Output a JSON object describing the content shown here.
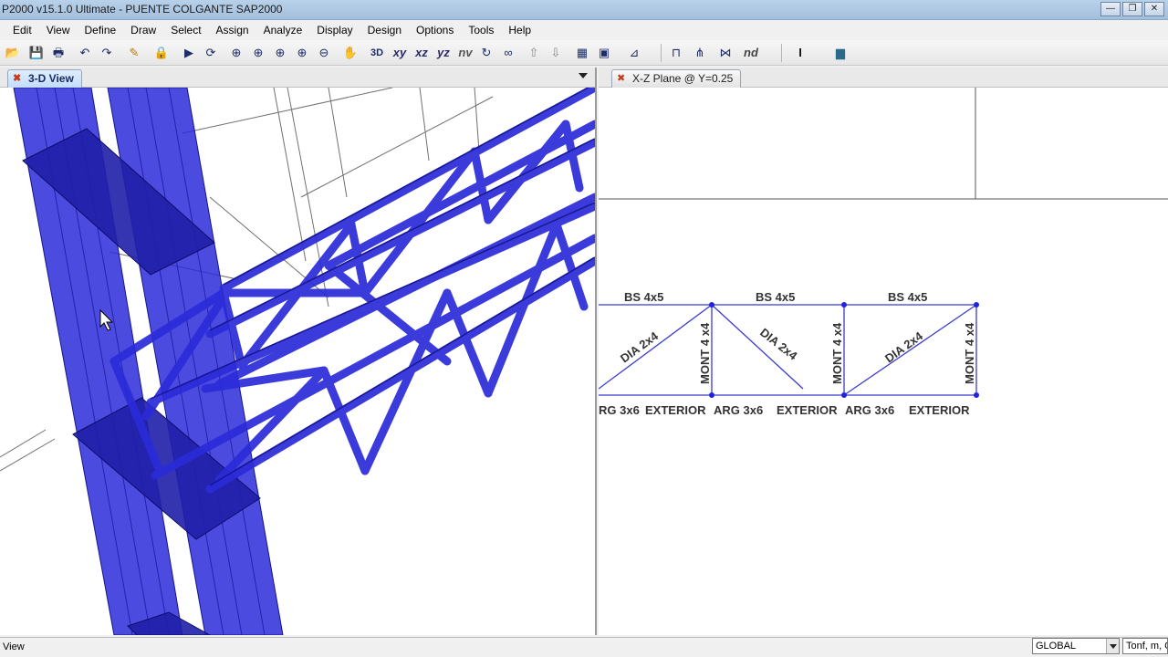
{
  "window": {
    "title": "P2000 v15.1.0 Ultimate  - PUENTE COLGANTE SAP2000",
    "buttons": {
      "minimize": "—",
      "restore": "❐",
      "close": "✕"
    }
  },
  "menu": [
    "Edit",
    "View",
    "Define",
    "Draw",
    "Select",
    "Assign",
    "Analyze",
    "Display",
    "Design",
    "Options",
    "Tools",
    "Help"
  ],
  "toolbar": {
    "items": [
      {
        "name": "open-icon",
        "glyph": "📂"
      },
      {
        "name": "save-icon",
        "glyph": "💾"
      },
      {
        "name": "print-icon",
        "glyph": "🖶"
      },
      {
        "name": "undo-icon",
        "glyph": "↶"
      },
      {
        "name": "redo-icon",
        "glyph": "↷"
      },
      {
        "name": "pencil-icon",
        "glyph": "✎"
      },
      {
        "name": "lock-icon",
        "glyph": "🔒"
      },
      {
        "name": "run-icon",
        "glyph": "▶"
      },
      {
        "name": "refresh-icon",
        "glyph": "⟳"
      },
      {
        "name": "zoom-window-icon",
        "glyph": "⊕"
      },
      {
        "name": "zoom-extents-icon",
        "glyph": "⊕"
      },
      {
        "name": "zoom-previous-icon",
        "glyph": "⊕"
      },
      {
        "name": "zoom-in-icon",
        "glyph": "⊕"
      },
      {
        "name": "zoom-out-icon",
        "glyph": "⊖"
      },
      {
        "name": "pan-icon",
        "glyph": "✋"
      },
      {
        "name": "3d-view-icon",
        "glyph": "3D"
      },
      {
        "name": "xy-view-icon",
        "text": "xy"
      },
      {
        "name": "xz-view-icon",
        "text": "xz"
      },
      {
        "name": "yz-view-icon",
        "text": "yz"
      },
      {
        "name": "nv-view-icon",
        "text": "nv"
      },
      {
        "name": "rotate-3d-icon",
        "glyph": "↻"
      },
      {
        "name": "perspective-icon",
        "glyph": "∞"
      },
      {
        "name": "move-up-icon",
        "glyph": "⇧"
      },
      {
        "name": "move-down-icon",
        "glyph": "⇩"
      },
      {
        "name": "view-options-icon",
        "glyph": "▦"
      },
      {
        "name": "display-icon",
        "glyph": "▣"
      },
      {
        "name": "snap-icon",
        "glyph": "⊿"
      },
      {
        "name": "frame-icon",
        "glyph": "⊓"
      },
      {
        "name": "draw-frame-icon",
        "glyph": "⋔"
      },
      {
        "name": "draw-cable-icon",
        "glyph": "⋈"
      },
      {
        "name": "node-icon",
        "text": "nd"
      },
      {
        "name": "section-icon",
        "glyph": "I"
      },
      {
        "name": "color-icon",
        "glyph": "▆"
      }
    ]
  },
  "left_panel": {
    "tab": "3-D View"
  },
  "right_panel": {
    "tab": "X-Z Plane @ Y=0.25",
    "truss_labels": {
      "top_chords": [
        "BS 4x5",
        "BS 4x5",
        "BS 4x5"
      ],
      "diagonals": [
        "DIA 2x4",
        "DIA 2x4",
        "DIA 2x4"
      ],
      "verticals": [
        "MONT 4 x4",
        "MONT 4 x4",
        "MONT 4 x4"
      ],
      "bottom_chords": [
        "RG 3x6",
        "EXTERIOR",
        "ARG 3x6",
        "EXTERIOR",
        "ARG 3x6",
        "EXTERIOR"
      ]
    }
  },
  "status": {
    "text": "View",
    "coord_system": "GLOBAL",
    "units": "Tonf, m, C"
  },
  "colors": {
    "frame_blue": "#2b2bd9",
    "frame_dark": "#1818a0",
    "joint_blue": "#2222dd",
    "label_gray": "#333333"
  }
}
